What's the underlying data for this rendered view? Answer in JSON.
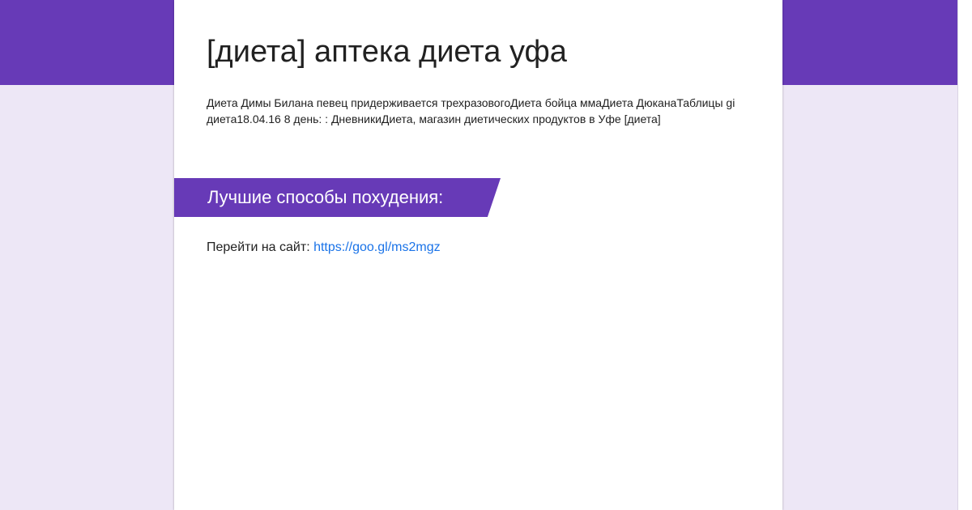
{
  "colors": {
    "theme": "#673ab7",
    "background": "#ede7f6",
    "card": "#ffffff",
    "link": "#1a73e8"
  },
  "form": {
    "title": "[диета] аптека диета уфа",
    "description": "Диета Димы Билана певец придерживается трехразовогоДиета бойца ммаДиета ДюканаТаблицы gi диета18.04.16 8 день: : ДневникиДиета, магазин диетических продуктов в Уфе [диета]"
  },
  "section": {
    "title": "Лучшие способы похудения:",
    "text_prefix": "Перейти на сайт: ",
    "link_text": "https://goo.gl/ms2mgz"
  }
}
